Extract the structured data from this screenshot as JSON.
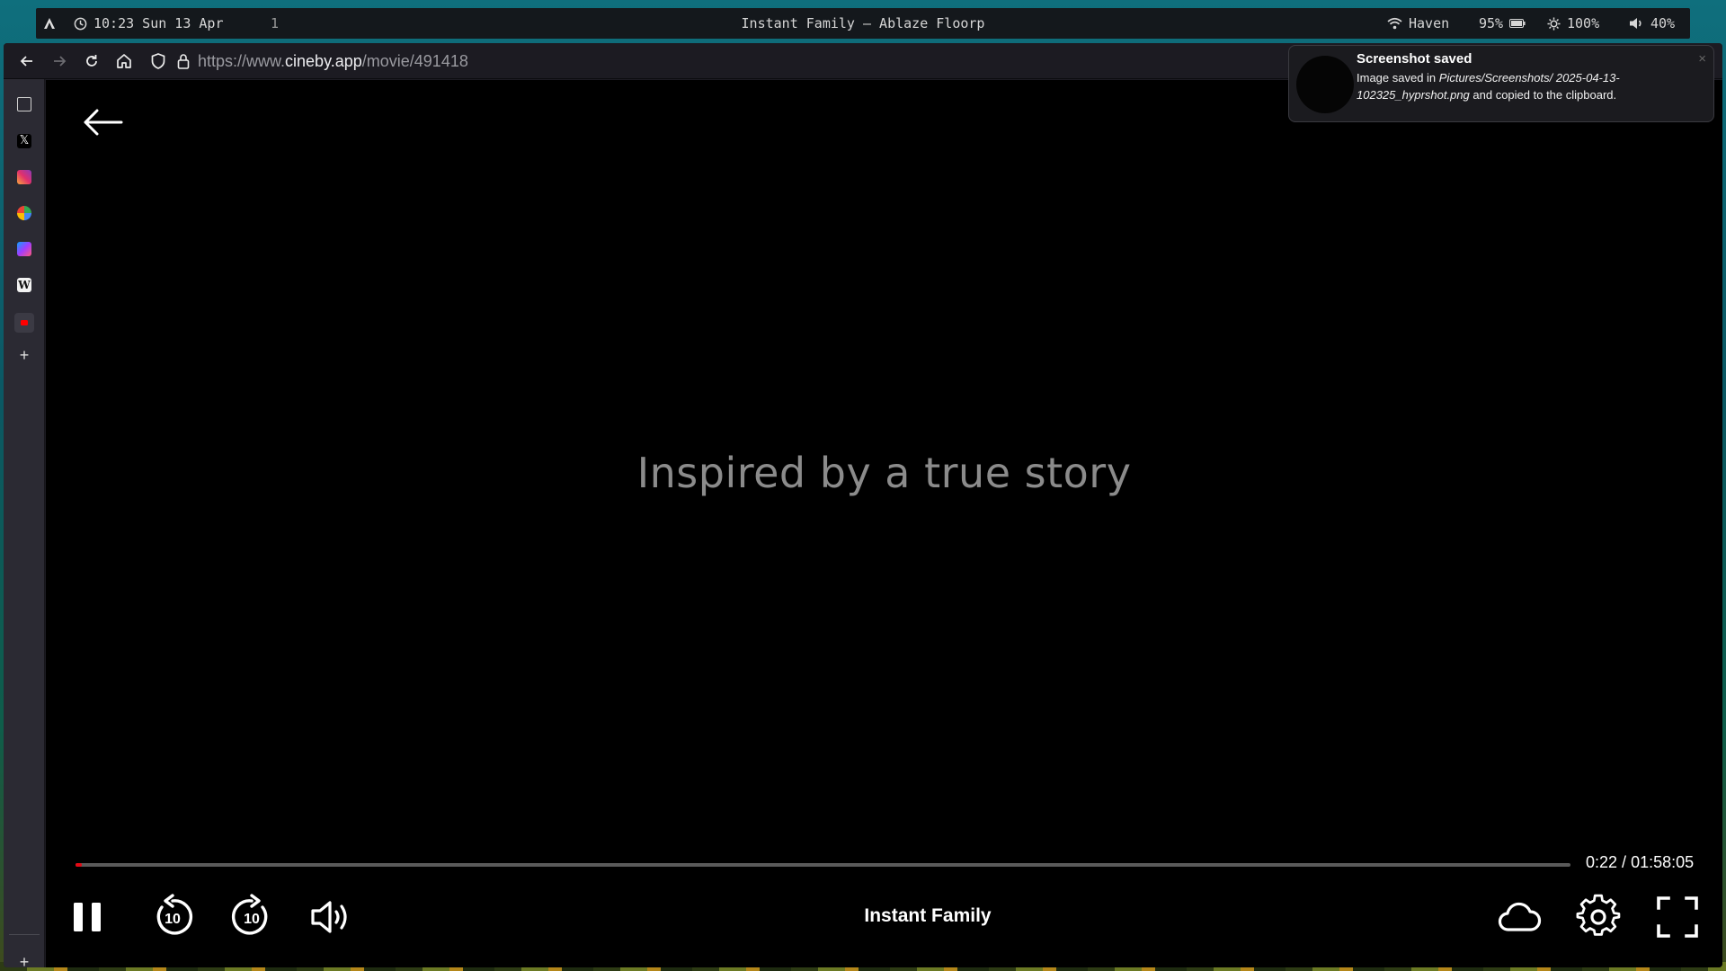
{
  "waybar": {
    "clock": "10:23 Sun 13 Apr",
    "workspace": "1",
    "window_title": "Instant Family — Ablaze Floorp",
    "wifi": "Haven",
    "battery": "95%",
    "brightness": "100%",
    "volume": "40%"
  },
  "browser": {
    "url_prefix": "https://www.",
    "url_domain": "cineby.app",
    "url_path": "/movie/491418"
  },
  "sidebar": {
    "items": [
      {
        "icon": "container-icon"
      },
      {
        "icon": "x-icon"
      },
      {
        "icon": "instagram-icon"
      },
      {
        "icon": "multicolor-app-icon"
      },
      {
        "icon": "messenger-icon"
      },
      {
        "icon": "wikipedia-icon"
      },
      {
        "icon": "youtube-icon"
      }
    ]
  },
  "player": {
    "subtitle": "Inspired by a true story",
    "title": "Instant Family",
    "time_current": "0:22",
    "time_total": "01:58:05",
    "time_separator": " / ",
    "progress_fraction": 0.0031,
    "accent": "#e50914",
    "skip_back_label": "10",
    "skip_forward_label": "10"
  },
  "notification": {
    "title": "Screenshot saved",
    "body_prefix": "Image saved in ",
    "body_path": "Pictures/Screenshots/ 2025-04-13-102325_hyprshot.png",
    "body_suffix": " and copied to the clipboard.",
    "close_glyph": "×"
  }
}
